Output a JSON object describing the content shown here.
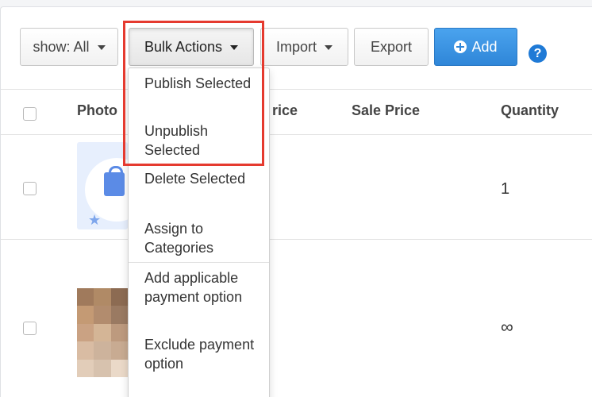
{
  "toolbar": {
    "show_label": "show: All",
    "bulk_actions_label": "Bulk Actions",
    "import_label": "Import",
    "export_label": "Export",
    "add_label": "Add",
    "help_label": "?"
  },
  "table": {
    "columns": [
      "Photo",
      "rice",
      "Sale Price",
      "Quantity"
    ],
    "rows": [
      {
        "quantity": "1"
      },
      {
        "quantity": "∞"
      }
    ]
  },
  "bulk_menu": {
    "items": [
      "Publish Selected",
      "Unpublish Selected",
      "Delete Selected",
      "Assign to Categories",
      "Add applicable payment option",
      "Exclude payment option"
    ]
  },
  "colors": {
    "highlight": "#e53a2f",
    "accent": "#2f86d8",
    "help_icon": "#1f7ad6"
  },
  "mosaic_colors": [
    "#a07a5c",
    "#b08a66",
    "#8c6b52",
    "#c49a74",
    "#b28c6e",
    "#9a7a62",
    "#caa283",
    "#d4b596",
    "#bd9a7e",
    "#d9bca3",
    "#cdb39c",
    "#c8ab92",
    "#e2cdb9",
    "#d7c2ae",
    "#ead9c8"
  ]
}
